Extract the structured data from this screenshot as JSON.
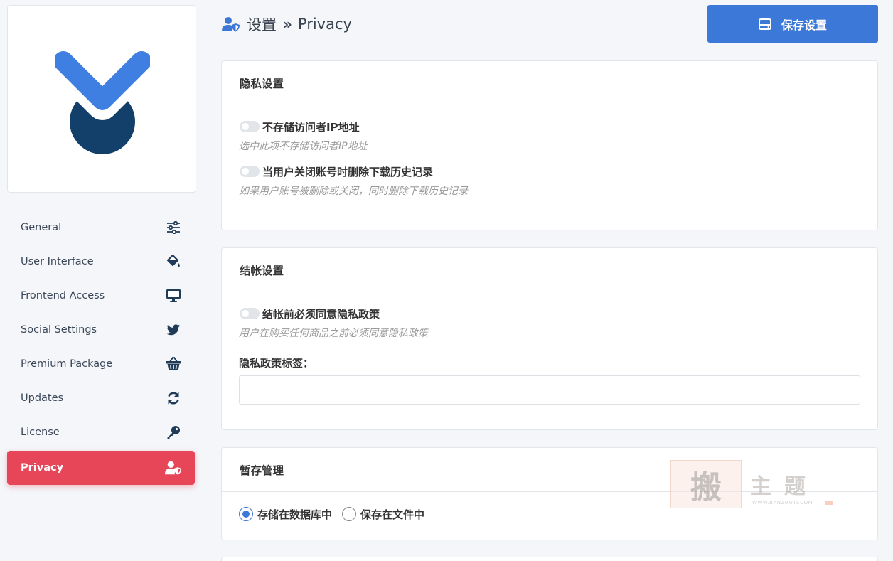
{
  "header": {
    "breadcrumb_root": "设置",
    "breadcrumb_sep": "»",
    "breadcrumb_current": "Privacy",
    "save_label": "保存设置"
  },
  "sidebar": {
    "items": [
      {
        "label": "General",
        "icon": "sliders-icon"
      },
      {
        "label": "User Interface",
        "icon": "paint-bucket-icon"
      },
      {
        "label": "Frontend Access",
        "icon": "monitor-icon"
      },
      {
        "label": "Social Settings",
        "icon": "twitter-icon"
      },
      {
        "label": "Premium Package",
        "icon": "basket-icon"
      },
      {
        "label": "Updates",
        "icon": "refresh-icon"
      },
      {
        "label": "License",
        "icon": "key-icon"
      },
      {
        "label": "Privacy",
        "icon": "user-shield-icon",
        "active": true
      }
    ]
  },
  "privacy_panel": {
    "title": "隐私设置",
    "options": [
      {
        "label": "不存储访问者IP地址",
        "desc": "选中此项不存储访问者IP地址",
        "enabled": false
      },
      {
        "label": "当用户关闭账号时删除下载历史记录",
        "desc": "如果用户账号被删除或关闭，同时删除下载历史记录",
        "enabled": false
      }
    ]
  },
  "checkout_panel": {
    "title": "结帐设置",
    "option": {
      "label": "结帐前必须同意隐私政策",
      "desc": "用户在购买任何商品之前必须同意隐私政策",
      "enabled": false
    },
    "field_label": "隐私政策标签：",
    "field_value": ""
  },
  "cache_panel": {
    "title": "暂存管理",
    "options": [
      {
        "label": "存储在数据库中",
        "checked": true
      },
      {
        "label": "保存在文件中",
        "checked": false
      }
    ]
  },
  "watermark": {
    "glyph": "搬",
    "text": "主题",
    "url": "WWW.BANZHUTI.COM"
  },
  "colors": {
    "accent": "#3c78d8",
    "active_nav": "#e74658",
    "logo_blue": "#3f7fe2",
    "logo_dark": "#12406b"
  }
}
